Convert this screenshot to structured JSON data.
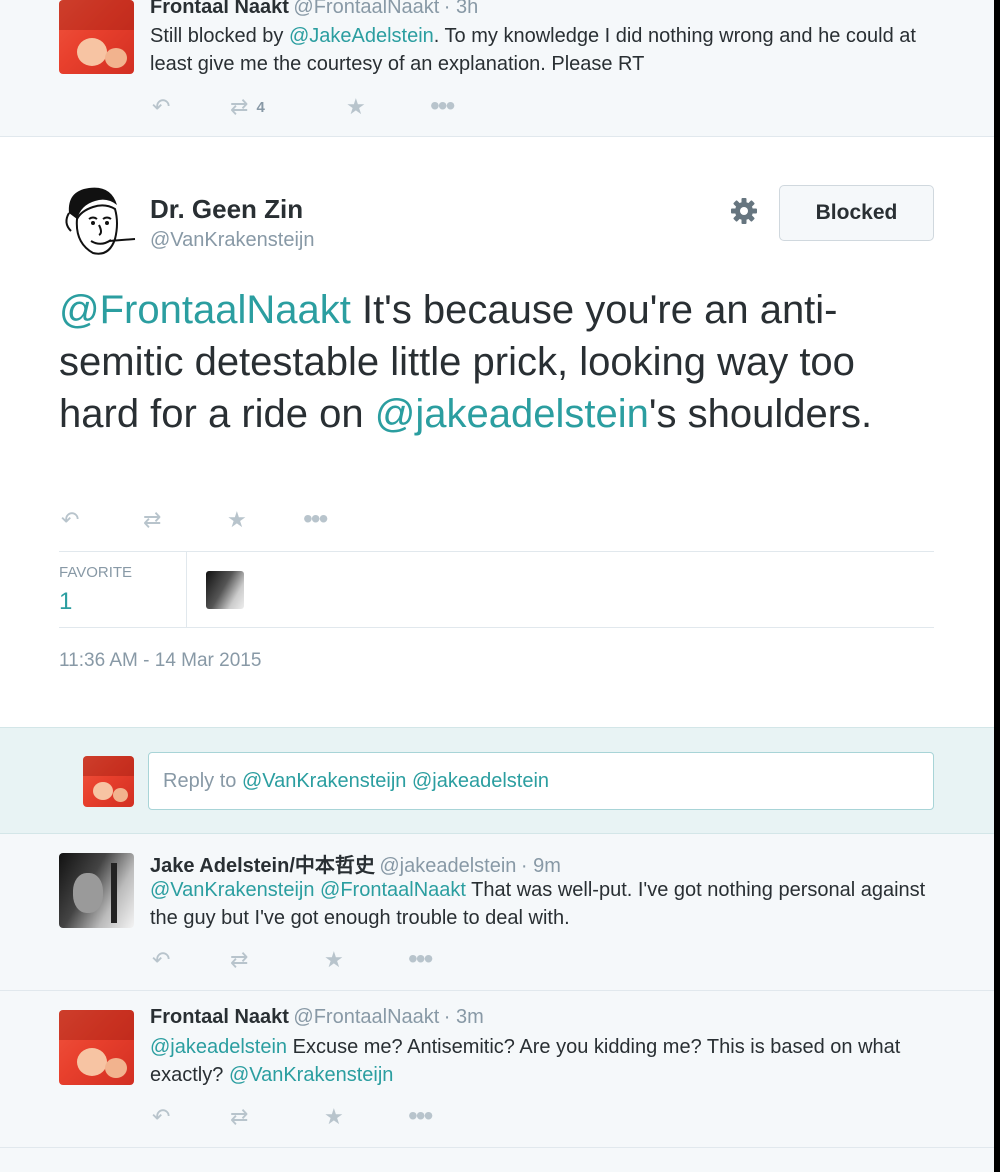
{
  "tweets": [
    {
      "name": "Frontaal Naakt",
      "handle": "@FrontaalNaakt",
      "time": "· 3h",
      "text_parts": [
        "Still blocked by ",
        "@JakeAdelstein",
        ". To my knowledge I did nothing wrong and he could at least give me the courtesy of an explanation. Please RT"
      ],
      "retweet_count": "4"
    },
    {
      "name": "Jake Adelstein/中本哲史",
      "handle": "@jakeadelstein",
      "time": "· 9m",
      "text_parts": [
        "@VanKrakensteijn",
        " ",
        "@FrontaalNaakt",
        " That was well-put. I've got nothing personal against the guy but I've got enough trouble to deal with."
      ]
    },
    {
      "name": "Frontaal Naakt",
      "handle": "@FrontaalNaakt",
      "time": "· 3m",
      "text_parts": [
        "@jakeadelstein",
        " Excuse me? Antisemitic? Are you kidding me? This is based on what exactly? ",
        "@VanKrakensteijn"
      ]
    }
  ],
  "main": {
    "name": "Dr. Geen Zin",
    "handle": "@VanKrakensteijn",
    "blocked_label": "Blocked",
    "text_parts": [
      "@FrontaalNaakt",
      " It's because you're an anti-semitic detestable little prick, looking way too hard for a ride on ",
      "@jakeadelstein",
      "'s shoulders."
    ],
    "favorite_label": "FAVORITE",
    "favorite_count": "1",
    "timestamp": "11:36 AM - 14 Mar 2015"
  },
  "reply": {
    "placeholder_prefix": "Reply to ",
    "placeholder_mentions": "@VanKrakensteijn @jakeadelstein"
  },
  "colors": {
    "link": "#2b9ea0",
    "muted": "#8899a6",
    "text": "#292f33",
    "bg_light": "#f5f8fa"
  },
  "icons": {
    "reply": "reply-icon",
    "retweet": "retweet-icon",
    "favorite": "star-icon",
    "more": "more-icon",
    "settings": "gear-icon"
  }
}
